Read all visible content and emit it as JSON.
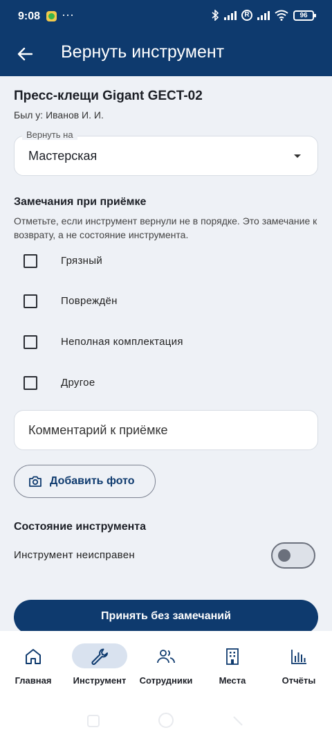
{
  "status_bar": {
    "time": "9:08",
    "more": "···",
    "battery": "96",
    "registered": "R"
  },
  "appbar": {
    "title": "Вернуть инструмент"
  },
  "tool": {
    "name": "Пресс-клещи Gigant GECT-02",
    "was_at": "Был у: Иванов И. И."
  },
  "return_to": {
    "label": "Вернуть на",
    "value": "Мастерская"
  },
  "remarks": {
    "title": "Замечания при приёмке",
    "hint": "Отметьте, если инструмент вернули не в порядке. Это замечание к возврату, а не состояние инструмента.",
    "options": [
      {
        "label": "Грязный",
        "checked": false
      },
      {
        "label": "Повреждён",
        "checked": false
      },
      {
        "label": "Неполная комплектация",
        "checked": false
      },
      {
        "label": "Другое",
        "checked": false
      }
    ]
  },
  "comment": {
    "placeholder": "Комментарий к приёмке"
  },
  "photo": {
    "label": "Добавить фото"
  },
  "condition": {
    "title": "Состояние инструмента",
    "faulty_label": "Инструмент неисправен",
    "faulty": false
  },
  "accept_button": "Принять без замечаний",
  "nav": {
    "items": [
      {
        "label": "Главная",
        "icon": "home-icon",
        "active": false
      },
      {
        "label": "Инструмент",
        "icon": "wrench-icon",
        "active": true
      },
      {
        "label": "Сотрудники",
        "icon": "people-icon",
        "active": false
      },
      {
        "label": "Места",
        "icon": "building-icon",
        "active": false
      },
      {
        "label": "Отчёты",
        "icon": "bar-chart-icon",
        "active": false
      }
    ]
  },
  "colors": {
    "primary": "#0e3a6e",
    "background": "#eef1f6",
    "nav_active_pill": "#d9e2ef"
  }
}
